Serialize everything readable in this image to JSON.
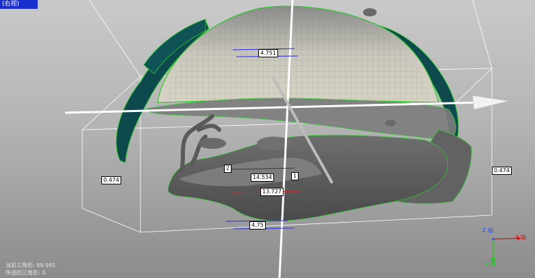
{
  "view": {
    "label": "(右视)"
  },
  "measurements": {
    "top_width": "4.751",
    "left_height": "0.474",
    "right_height": "0.474",
    "center_length": "14.534",
    "red_length": "13.727",
    "bottom_width": "4.75",
    "marker_1": "1",
    "marker_2": "2"
  },
  "axes": {
    "z_label": "Z 轴",
    "x_label": "X 轴",
    "y_label": "Y 轴"
  },
  "status": {
    "current_label": "当前三角形:",
    "current_value": "89.991",
    "selected_label": "所选的三角形:",
    "selected_value": "0"
  },
  "colors": {
    "view_badge": "#1a2fd0",
    "mesh_teal": "#0e4a4d",
    "mesh_outline": "#2ec72e",
    "axis_x": "#e01010",
    "axis_y": "#10d010",
    "axis_z": "#2050ff",
    "measure_line_blue": "#2a2ae0",
    "measure_line_red": "#e02020"
  }
}
